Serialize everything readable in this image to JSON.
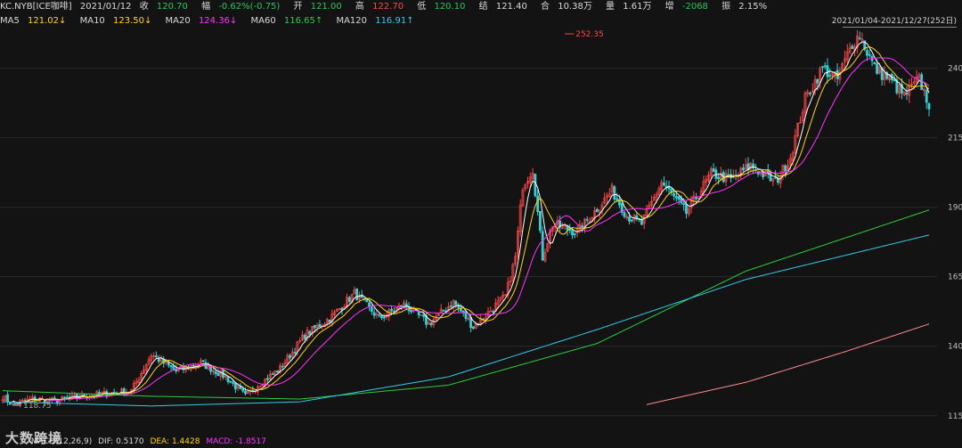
{
  "header": {
    "symbol": "KC.NYB[ICE咖啡]",
    "date": "2021/01/12",
    "close_label": "收",
    "close": "120.70",
    "chg_label": "幅",
    "chg": "-0.62%(-0.75)",
    "open_label": "开",
    "open": "121.00",
    "high_label": "高",
    "high": "122.70",
    "low_label": "低",
    "low": "120.10",
    "settle_label": "结",
    "settle": "121.40",
    "oi_label": "合",
    "oi": "10.38万",
    "vol_label": "量",
    "vol": "1.61万",
    "inc_label": "增",
    "inc": "-2068",
    "amp_label": "振",
    "amp": "2.15%"
  },
  "ma_row": {
    "ma5_label": "MA5",
    "ma5": "121.02↓",
    "ma10_label": "MA10",
    "ma10": "123.50↓",
    "ma20_label": "MA20",
    "ma20": "124.36↓",
    "ma60_label": "MA60",
    "ma60": "116.65↑",
    "ma120_label": "MA120",
    "ma120": "116.91↑"
  },
  "range": "2021/01/04-2021/12/27(252日)",
  "footer": {
    "macd_label": "MACD(12,26,9)",
    "dif": "DIF: 0.5170",
    "dea": "DEA: 1.4428",
    "macd": "MACD: -1.8517"
  },
  "watermark": "大数跨境",
  "colors": {
    "up": "#ff4545",
    "down": "#2fd3d3",
    "ma5": "#ffffff",
    "ma10": "#ffd700",
    "ma20": "#ff33ff",
    "ma60": "#2ecc40",
    "ma120": "#38c8e8",
    "ma250": "#ff8a8a"
  },
  "chart_data": {
    "type": "candlestick",
    "title": "KC.NYB[ICE咖啡]",
    "ylim": [
      113,
      253
    ],
    "yticks": [
      115,
      140,
      165,
      190,
      215,
      240
    ],
    "annotations": [
      {
        "text": "252.35",
        "type": "max",
        "day": 227,
        "value": 252.35
      },
      {
        "text": "118.75",
        "type": "min",
        "day": 4,
        "value": 118.75
      }
    ],
    "key_points": [
      [
        0,
        122
      ],
      [
        4,
        119
      ],
      [
        12,
        121
      ],
      [
        22,
        120.5
      ],
      [
        32,
        122
      ],
      [
        42,
        123
      ],
      [
        52,
        124
      ],
      [
        60,
        137
      ],
      [
        70,
        131
      ],
      [
        80,
        134
      ],
      [
        90,
        129
      ],
      [
        98,
        122
      ],
      [
        103,
        126
      ],
      [
        112,
        132
      ],
      [
        122,
        144
      ],
      [
        132,
        150
      ],
      [
        142,
        159
      ],
      [
        152,
        150
      ],
      [
        162,
        155
      ],
      [
        172,
        148
      ],
      [
        182,
        156
      ],
      [
        190,
        147
      ],
      [
        196,
        152
      ],
      [
        203,
        158
      ],
      [
        207,
        172
      ],
      [
        210,
        198
      ],
      [
        214,
        204
      ],
      [
        218,
        172
      ],
      [
        222,
        184
      ],
      [
        232,
        181
      ],
      [
        246,
        196
      ],
      [
        252,
        187
      ],
      [
        258,
        184
      ],
      [
        266,
        199
      ],
      [
        276,
        188
      ],
      [
        286,
        202
      ],
      [
        294,
        200
      ],
      [
        302,
        205
      ],
      [
        312,
        199
      ],
      [
        318,
        208
      ],
      [
        324,
        229
      ],
      [
        331,
        240
      ],
      [
        337,
        236
      ],
      [
        343,
        249
      ],
      [
        346,
        252
      ],
      [
        352,
        240
      ],
      [
        358,
        236
      ],
      [
        364,
        230
      ],
      [
        370,
        236
      ],
      [
        374,
        227
      ]
    ],
    "ma_series": [
      {
        "name": "MA5",
        "color_key": "ma5",
        "period": 5
      },
      {
        "name": "MA10",
        "color_key": "ma10",
        "period": 10
      },
      {
        "name": "MA20",
        "color_key": "ma20",
        "period": 20
      },
      {
        "name": "MA60",
        "color_key": "ma60",
        "points": [
          [
            0,
            124
          ],
          [
            60,
            122
          ],
          [
            120,
            121
          ],
          [
            180,
            126
          ],
          [
            240,
            141
          ],
          [
            300,
            167
          ],
          [
            374,
            189
          ]
        ]
      },
      {
        "name": "MA120",
        "color_key": "ma120",
        "points": [
          [
            0,
            120
          ],
          [
            60,
            118.5
          ],
          [
            120,
            120
          ],
          [
            180,
            129
          ],
          [
            240,
            146
          ],
          [
            300,
            164
          ],
          [
            374,
            180
          ]
        ]
      },
      {
        "name": "MA250",
        "color_key": "ma250",
        "points": [
          [
            260,
            119
          ],
          [
            300,
            127
          ],
          [
            340,
            138
          ],
          [
            374,
            148
          ]
        ]
      }
    ]
  }
}
